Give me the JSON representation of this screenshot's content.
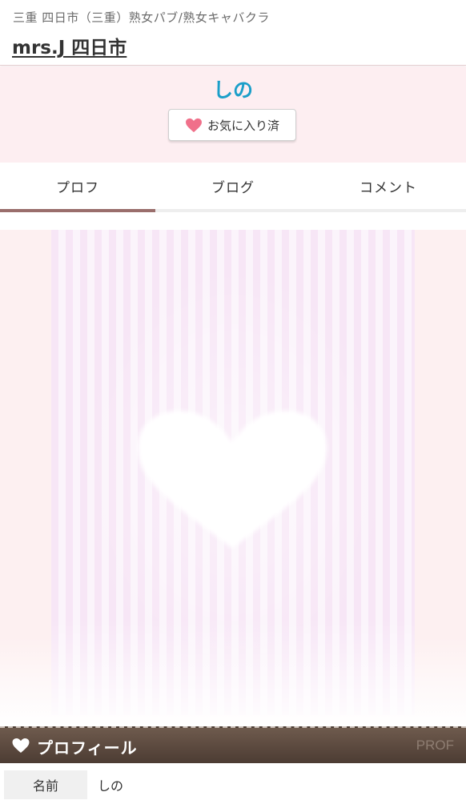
{
  "header": {
    "breadcrumb": "三重 四日市（三重）熟女パブ/熟女キャバクラ",
    "shop_name": "mrs.J 四日市"
  },
  "cast": {
    "name": "しの",
    "favorite_button": {
      "label": "お気に入り済",
      "icon": "heart-icon",
      "icon_color": "#f0708a"
    }
  },
  "tabs": [
    {
      "label": "プロフ",
      "active": true
    },
    {
      "label": "ブログ",
      "active": false
    },
    {
      "label": "コメント",
      "active": false
    }
  ],
  "photo": {
    "placeholder": "heart-stripe-image"
  },
  "profile_section": {
    "title": "プロフィール",
    "title_en": "PROF",
    "icon": "heart-icon",
    "rows": [
      {
        "label": "名前",
        "value": "しの"
      }
    ]
  },
  "colors": {
    "accent_blue": "#1b9fc9",
    "band_pink": "#fdeef1",
    "tab_active": "#9a6e6c",
    "section_bar": "#5b4a3f"
  }
}
